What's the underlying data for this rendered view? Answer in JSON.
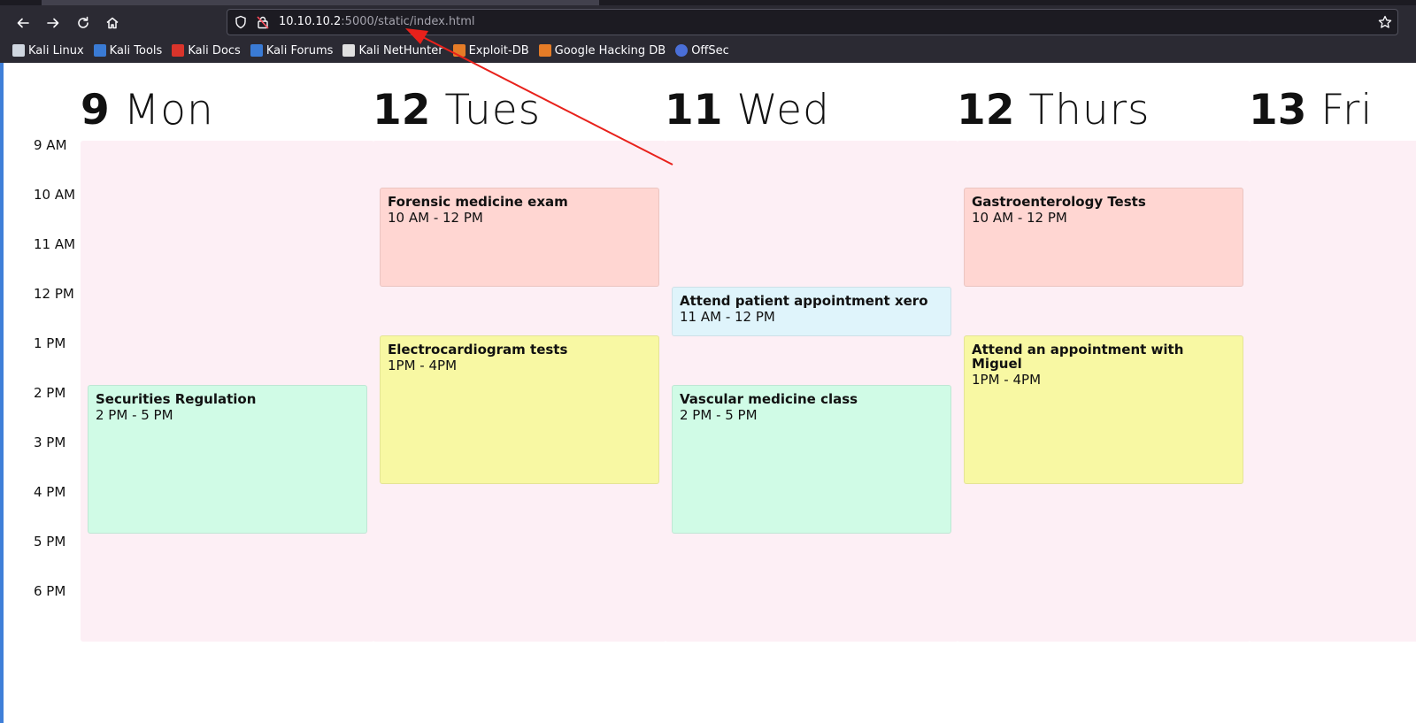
{
  "browser": {
    "url_host": "10.10.10.2",
    "url_rest": ":5000/static/index.html",
    "icons": {
      "back": "back-arrow-icon",
      "forward": "forward-arrow-icon",
      "reload": "reload-icon",
      "home": "home-icon",
      "shield": "shield-icon",
      "lock": "insecure-lock-icon",
      "star": "bookmark-star-icon"
    },
    "bookmarks": [
      {
        "label": "Kali Linux",
        "color": "#cfd6e0"
      },
      {
        "label": "Kali Tools",
        "color": "#3a7bd5"
      },
      {
        "label": "Kali Docs",
        "color": "#d9342b"
      },
      {
        "label": "Kali Forums",
        "color": "#3a7bd5"
      },
      {
        "label": "Kali NetHunter",
        "color": "#e0e0e0"
      },
      {
        "label": "Exploit-DB",
        "color": "#e57c27"
      },
      {
        "label": "Google Hacking DB",
        "color": "#e57c27"
      },
      {
        "label": "OffSec",
        "color": "#4a6fd8"
      }
    ]
  },
  "calendar": {
    "days": [
      {
        "num": "9",
        "name": "Mon"
      },
      {
        "num": "12",
        "name": "Tues"
      },
      {
        "num": "11",
        "name": "Wed"
      },
      {
        "num": "12",
        "name": "Thurs"
      },
      {
        "num": "13",
        "name": "Fri"
      }
    ],
    "times": [
      "9 AM",
      "10 AM",
      "11 AM",
      "12 PM",
      "1 PM",
      "2 PM",
      "3 PM",
      "4 PM",
      "5 PM",
      "6 PM"
    ],
    "events": [
      {
        "title": "Securities Regulation",
        "time": "2 PM - 5 PM",
        "color": "#d0fbe6"
      },
      {
        "title": "Forensic medicine exam",
        "time": "10 AM - 12 PM",
        "color": "#ffd6d2"
      },
      {
        "title": "Electrocardiogram tests",
        "time": "1PM - 4PM",
        "color": "#f8f8a3"
      },
      {
        "title": "Attend patient appointment xero",
        "time": "11 AM - 12 PM",
        "color": "#dff4fb"
      },
      {
        "title": "Vascular medicine class",
        "time": "2 PM - 5 PM",
        "color": "#d0fbe6"
      },
      {
        "title": "Gastroenterology Tests",
        "time": "10 AM - 12 PM",
        "color": "#ffd6d2"
      },
      {
        "title": "Attend an appointment with Miguel",
        "time": "1PM - 4PM",
        "color": "#f8f8a3"
      }
    ],
    "column_bg": "#fdeff5"
  },
  "annotation": {
    "color": "#e8211b"
  }
}
